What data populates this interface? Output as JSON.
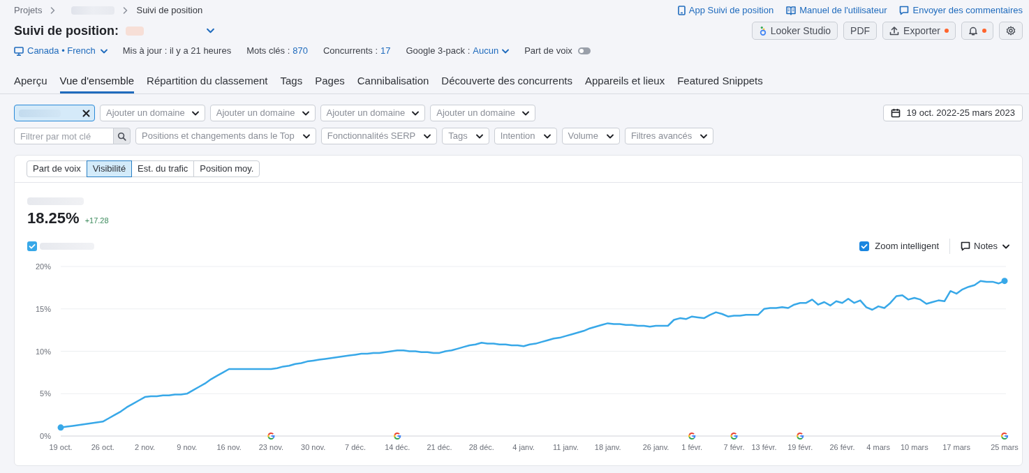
{
  "breadcrumb": [
    {
      "kind": "link",
      "label": "Projets"
    },
    {
      "kind": "redacted"
    },
    {
      "kind": "current",
      "label": "Suivi de position"
    }
  ],
  "header_links": [
    {
      "kind": "app",
      "label": "App Suivi de position"
    },
    {
      "kind": "manual",
      "label": "Manuel de l'utilisateur"
    },
    {
      "kind": "feedback",
      "label": "Envoyer des commentaires"
    }
  ],
  "title": "Suivi de position:",
  "actions": [
    {
      "kind": "looker",
      "label": "Looker Studio",
      "dot": false
    },
    {
      "kind": "pdf",
      "label": "PDF",
      "dot": false
    },
    {
      "kind": "export",
      "label": "Exporter",
      "dot": true
    },
    {
      "kind": "notifications",
      "dot": true
    },
    {
      "kind": "settings",
      "dot": false
    }
  ],
  "meta": {
    "location": "Canada • French",
    "updated": "Mis à jour : il y a 21 heures",
    "stats": [
      {
        "kind": "link",
        "label": "Mots clés :",
        "value": "870"
      },
      {
        "kind": "link",
        "label": "Concurrents :",
        "value": "17"
      },
      {
        "kind": "dropdown",
        "label": "Google 3-pack :",
        "value": "Aucun"
      }
    ],
    "share_of_voice": {
      "label": "Part de voix",
      "on": false
    }
  },
  "tabs": [
    {
      "label": "Aperçu",
      "selected": false
    },
    {
      "label": "Vue d'ensemble",
      "selected": true
    },
    {
      "label": "Répartition du classement",
      "selected": false
    },
    {
      "label": "Tags",
      "selected": false
    },
    {
      "label": "Pages",
      "selected": false
    },
    {
      "label": "Cannibalisation",
      "selected": false
    },
    {
      "label": "Découverte des concurrents",
      "selected": false
    },
    {
      "label": "Appareils et lieux",
      "selected": false
    },
    {
      "label": "Featured Snippets",
      "selected": false
    }
  ],
  "filters": {
    "domains": [
      {
        "kind": "selected"
      },
      {
        "kind": "add",
        "label": "Ajouter un domaine"
      },
      {
        "kind": "add",
        "label": "Ajouter un domaine"
      },
      {
        "kind": "add",
        "label": "Ajouter un domaine"
      },
      {
        "kind": "add",
        "label": "Ajouter un domaine"
      }
    ],
    "date_range": "19 oct. 2022-25 mars 2023",
    "keyword_search": {
      "placeholder": "Filtrer par mot clé"
    },
    "dropdowns": [
      "Positions et changements dans le Top",
      "Fonctionnalités SERP",
      "Tags",
      "Intention",
      "Volume",
      "Filtres avancés"
    ]
  },
  "chart_panel": {
    "metric_tabs": [
      {
        "label": "Part de voix",
        "selected": false
      },
      {
        "label": "Visibilité",
        "selected": true
      },
      {
        "label": "Est. du trafic",
        "selected": false
      },
      {
        "label": "Position moy.",
        "selected": false
      }
    ],
    "value": "18.25%",
    "change": "+17.28",
    "legend": [
      {
        "checked": true
      }
    ],
    "smart_zoom": {
      "label": "Zoom intelligent",
      "checked": true
    },
    "notes": {
      "label": "Notes"
    },
    "chart_data": {
      "type": "line",
      "grid": true,
      "categories": [
        "19 oct.",
        null,
        null,
        null,
        null,
        null,
        null,
        "26 oct.",
        null,
        null,
        null,
        null,
        null,
        null,
        "2 nov.",
        null,
        null,
        null,
        null,
        null,
        null,
        "9 nov.",
        null,
        null,
        null,
        null,
        null,
        null,
        "16 nov.",
        null,
        null,
        null,
        null,
        null,
        null,
        "23 nov.",
        null,
        null,
        null,
        null,
        null,
        null,
        "30 nov.",
        null,
        null,
        null,
        null,
        null,
        null,
        "7 déc.",
        null,
        null,
        null,
        null,
        null,
        null,
        "14 déc.",
        null,
        null,
        null,
        null,
        null,
        null,
        "21 déc.",
        null,
        null,
        null,
        null,
        null,
        null,
        "28 déc.",
        null,
        null,
        null,
        null,
        null,
        null,
        "4 janv.",
        null,
        null,
        null,
        null,
        null,
        null,
        "11 janv.",
        null,
        null,
        null,
        null,
        null,
        null,
        "18 janv.",
        null,
        null,
        null,
        null,
        null,
        null,
        null,
        "26 janv.",
        null,
        null,
        null,
        null,
        null,
        "1 févr.",
        null,
        null,
        null,
        null,
        null,
        null,
        "7 févr.",
        null,
        null,
        null,
        null,
        "13 févr.",
        null,
        null,
        null,
        null,
        null,
        "19 févr.",
        null,
        null,
        null,
        null,
        null,
        null,
        "26 févr.",
        null,
        null,
        null,
        null,
        null,
        "4 mars",
        null,
        null,
        null,
        null,
        null,
        "10 mars",
        null,
        null,
        null,
        null,
        null,
        null,
        "17 mars",
        null,
        null,
        null,
        null,
        null,
        null,
        null,
        "25 mars"
      ],
      "series": [
        {
          "color": "#38a8e8",
          "values": [
            1.0,
            1.1,
            1.2,
            1.3,
            1.4,
            1.5,
            1.6,
            1.7,
            2.1,
            2.5,
            2.9,
            3.4,
            3.8,
            4.2,
            4.6,
            4.7,
            4.7,
            4.8,
            4.8,
            4.9,
            4.9,
            5.0,
            5.4,
            5.8,
            6.2,
            6.7,
            7.1,
            7.5,
            7.9,
            7.9,
            7.9,
            7.9,
            7.9,
            7.9,
            7.9,
            7.9,
            8.0,
            8.2,
            8.3,
            8.5,
            8.6,
            8.8,
            8.9,
            9.0,
            9.1,
            9.2,
            9.3,
            9.4,
            9.5,
            9.6,
            9.7,
            9.7,
            9.8,
            9.8,
            9.9,
            10.0,
            10.1,
            10.1,
            10.0,
            10.0,
            9.9,
            9.9,
            9.8,
            9.8,
            10.0,
            10.1,
            10.3,
            10.5,
            10.7,
            10.8,
            11.0,
            10.9,
            10.9,
            10.8,
            10.8,
            10.7,
            10.7,
            10.6,
            10.8,
            10.9,
            11.1,
            11.3,
            11.5,
            11.6,
            11.8,
            12.0,
            12.2,
            12.4,
            12.7,
            12.9,
            13.1,
            13.3,
            13.2,
            13.2,
            13.1,
            13.1,
            13.0,
            13.0,
            12.9,
            13.0,
            13.0,
            13.0,
            13.7,
            13.9,
            13.8,
            14.1,
            14.0,
            13.9,
            14.3,
            14.6,
            14.4,
            14.1,
            14.2,
            14.2,
            14.3,
            14.3,
            14.3,
            15.0,
            15.1,
            15.1,
            15.2,
            15.1,
            15.5,
            15.7,
            15.7,
            16.1,
            15.5,
            15.8,
            15.4,
            15.9,
            15.7,
            16.2,
            15.7,
            16.0,
            15.2,
            14.9,
            15.3,
            15.1,
            15.7,
            16.5,
            16.6,
            16.1,
            16.3,
            16.1,
            15.6,
            15.8,
            16.0,
            15.9,
            17.1,
            16.8,
            17.3,
            17.6,
            17.8,
            18.3,
            18.2,
            18.2,
            18.0,
            18.3
          ]
        }
      ],
      "ylim": [
        0,
        20
      ],
      "yticks": [
        {
          "value": 0,
          "label": "0%"
        },
        {
          "value": 5,
          "label": "5%"
        },
        {
          "value": 10,
          "label": "10%"
        },
        {
          "value": 15,
          "label": "15%"
        },
        {
          "value": 20,
          "label": "20%"
        }
      ],
      "annotations": [
        {
          "x": "23 nov."
        },
        {
          "x": "14 déc."
        },
        {
          "x": "1 févr."
        },
        {
          "x": "7 févr."
        },
        {
          "x": "19 févr."
        },
        {
          "x": "25 mars"
        }
      ]
    }
  }
}
